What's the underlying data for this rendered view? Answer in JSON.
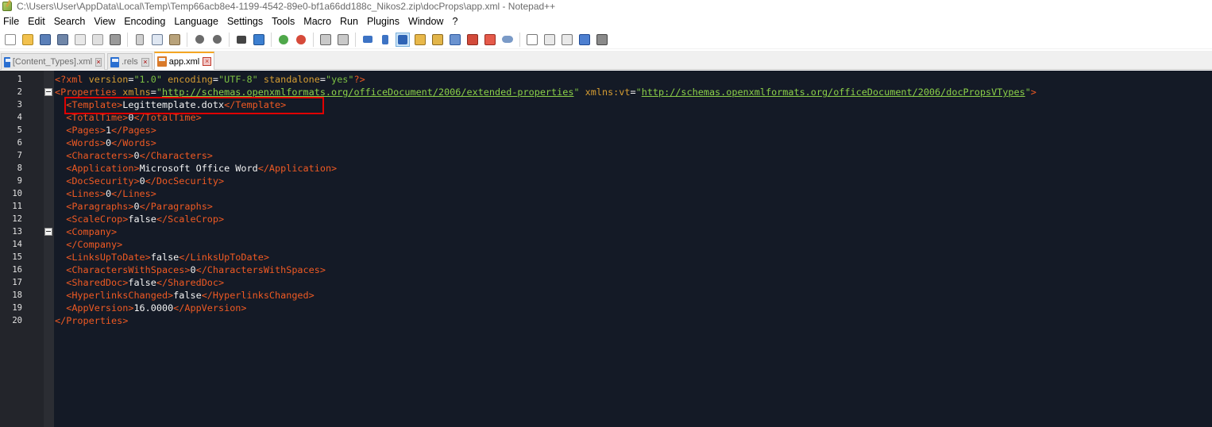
{
  "window": {
    "title": "C:\\Users\\User\\AppData\\Local\\Temp\\Temp66acb8e4-1199-4542-89e0-bf1a66dd188c_Nikos2.zip\\docProps\\app.xml - Notepad++"
  },
  "menu": [
    "File",
    "Edit",
    "Search",
    "View",
    "Encoding",
    "Language",
    "Settings",
    "Tools",
    "Macro",
    "Run",
    "Plugins",
    "Window",
    "?"
  ],
  "tabs": [
    {
      "label": "[Content_Types].xml",
      "active": false
    },
    {
      "label": ".rels",
      "active": false
    },
    {
      "label": "app.xml",
      "active": true
    }
  ],
  "editor": {
    "lines": [
      {
        "num": "1",
        "pi_open": "<?xml ",
        "a1": "version",
        "eq1": "=",
        "v1": "\"1.0\"",
        "sp1": " ",
        "a2": "encoding",
        "eq2": "=",
        "v2": "\"UTF-8\"",
        "sp2": " ",
        "a3": "standalone",
        "eq3": "=",
        "v3": "\"yes\"",
        "pi_close": "?>"
      },
      {
        "num": "2",
        "open": "<Properties ",
        "a1": "xmlns",
        "eq1": "=",
        "q1o": "\"",
        "link1": "http://schemas.openxmlformats.org/officeDocument/2006/extended-properties",
        "q1c": "\"",
        "sp": " ",
        "a2": "xmlns:vt",
        "eq2": "=",
        "q2o": "\"",
        "link2": "http://schemas.openxmlformats.org/officeDocument/2006/docPropsVTypes",
        "q2c": "\"",
        "close": ">"
      },
      {
        "num": "3",
        "indent": "  ",
        "o": "<Template>",
        "t": "Legittemplate.dotx",
        "c": "</Template>"
      },
      {
        "num": "4",
        "indent": "  ",
        "o": "<TotalTime>",
        "t": "0",
        "c": "</TotalTime>"
      },
      {
        "num": "5",
        "indent": "  ",
        "o": "<Pages>",
        "t": "1",
        "c": "</Pages>"
      },
      {
        "num": "6",
        "indent": "  ",
        "o": "<Words>",
        "t": "0",
        "c": "</Words>"
      },
      {
        "num": "7",
        "indent": "  ",
        "o": "<Characters>",
        "t": "0",
        "c": "</Characters>"
      },
      {
        "num": "8",
        "indent": "  ",
        "o": "<Application>",
        "t": "Microsoft Office Word",
        "c": "</Application>"
      },
      {
        "num": "9",
        "indent": "  ",
        "o": "<DocSecurity>",
        "t": "0",
        "c": "</DocSecurity>"
      },
      {
        "num": "10",
        "indent": "  ",
        "o": "<Lines>",
        "t": "0",
        "c": "</Lines>"
      },
      {
        "num": "11",
        "indent": "  ",
        "o": "<Paragraphs>",
        "t": "0",
        "c": "</Paragraphs>"
      },
      {
        "num": "12",
        "indent": "  ",
        "o": "<ScaleCrop>",
        "t": "false",
        "c": "</ScaleCrop>"
      },
      {
        "num": "13",
        "indent": "  ",
        "o": "<Company>",
        "t": "",
        "c": ""
      },
      {
        "num": "14",
        "indent": "  ",
        "o": "</Company>",
        "t": "",
        "c": ""
      },
      {
        "num": "15",
        "indent": "  ",
        "o": "<LinksUpToDate>",
        "t": "false",
        "c": "</LinksUpToDate>"
      },
      {
        "num": "16",
        "indent": "  ",
        "o": "<CharactersWithSpaces>",
        "t": "0",
        "c": "</CharactersWithSpaces>"
      },
      {
        "num": "17",
        "indent": "  ",
        "o": "<SharedDoc>",
        "t": "false",
        "c": "</SharedDoc>"
      },
      {
        "num": "18",
        "indent": "  ",
        "o": "<HyperlinksChanged>",
        "t": "false",
        "c": "</HyperlinksChanged>"
      },
      {
        "num": "19",
        "indent": "  ",
        "o": "<AppVersion>",
        "t": "16.0000",
        "c": "</AppVersion>"
      },
      {
        "num": "20",
        "indent": "",
        "o": "</Properties>",
        "t": "",
        "c": ""
      }
    ]
  },
  "colors": {
    "editor_bg": "#141a26",
    "tag": "#f05a23",
    "attr": "#d69d32",
    "value": "#7cc043",
    "highlight_box": "#e00000"
  }
}
